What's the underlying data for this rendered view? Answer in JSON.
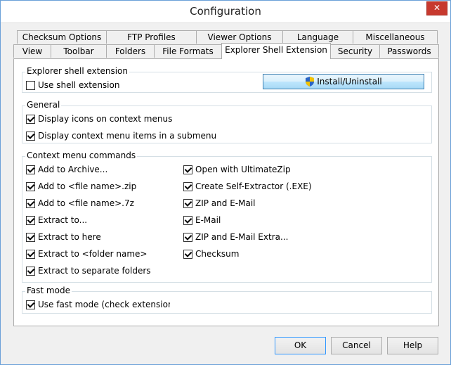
{
  "window": {
    "title": "Configuration",
    "close_glyph": "✕"
  },
  "tabs_row1": [
    "Checksum Options",
    "FTP Profiles",
    "Viewer Options",
    "Language",
    "Miscellaneous"
  ],
  "tabs_row2": [
    "View",
    "Toolbar",
    "Folders",
    "File Formats",
    "Explorer Shell Extension",
    "Security",
    "Passwords"
  ],
  "active_tab": "Explorer Shell Extension",
  "explorer_group": {
    "label": "Explorer shell extension",
    "use_shell": {
      "label": "Use shell extension",
      "checked": false
    },
    "install_button": "Install/Uninstall"
  },
  "general_group": {
    "label": "General",
    "items": [
      {
        "label": "Display icons on context menus",
        "checked": true
      },
      {
        "label": "Display context menu items in a submenu",
        "checked": true
      }
    ]
  },
  "context_group": {
    "label": "Context menu commands",
    "left": [
      {
        "label": "Add to Archive...",
        "checked": true
      },
      {
        "label": "Add to <file name>.zip",
        "checked": true
      },
      {
        "label": "Add to <file name>.7z",
        "checked": true
      },
      {
        "label": "Extract to...",
        "checked": true
      },
      {
        "label": "Extract to here",
        "checked": true
      },
      {
        "label": "Extract to <folder name>",
        "checked": true
      },
      {
        "label": "Extract to separate folders",
        "checked": true
      }
    ],
    "right": [
      {
        "label": "Open with UltimateZip",
        "checked": true
      },
      {
        "label": "Create Self-Extractor (.EXE)",
        "checked": true
      },
      {
        "label": "ZIP and E-Mail",
        "checked": true
      },
      {
        "label": "E-Mail",
        "checked": true
      },
      {
        "label": "ZIP and E-Mail Extra...",
        "checked": true
      },
      {
        "label": "Checksum",
        "checked": true
      }
    ]
  },
  "fast_group": {
    "label": "Fast mode",
    "item": {
      "label": "Use fast mode (check extension onl",
      "checked": true
    }
  },
  "buttons": {
    "ok": "OK",
    "cancel": "Cancel",
    "help": "Help"
  },
  "icons": {
    "close": "close-icon",
    "shield": "uac-shield-icon"
  }
}
